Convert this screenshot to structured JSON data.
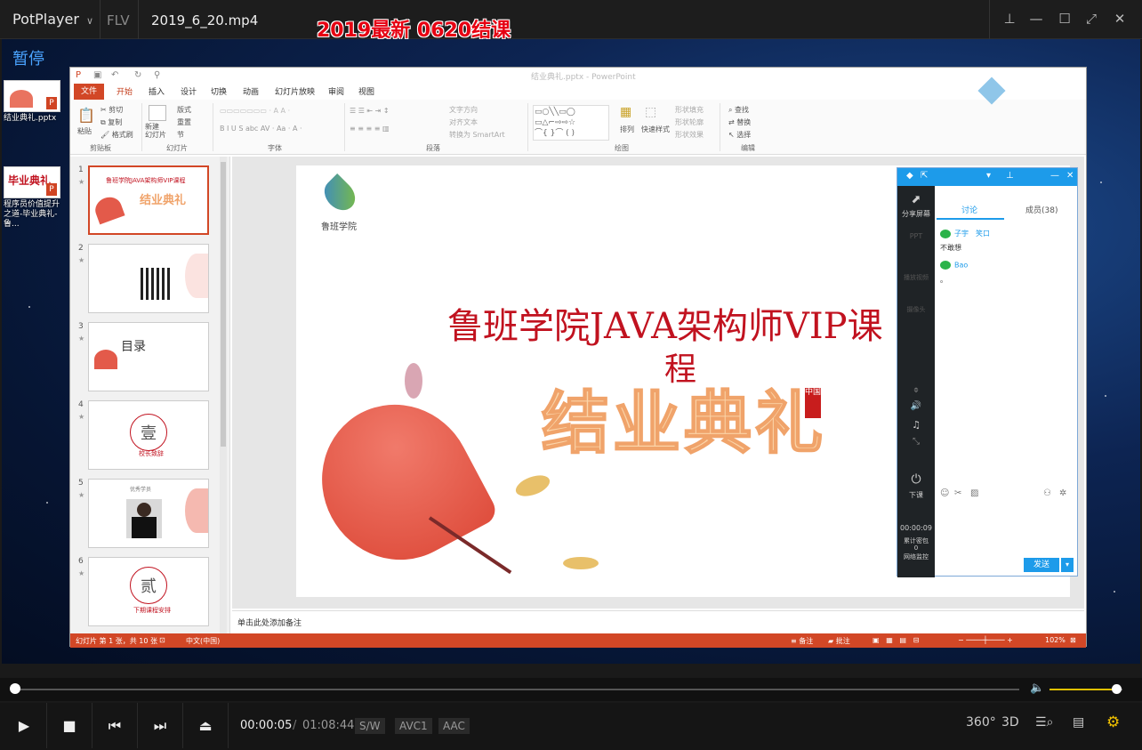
{
  "player": {
    "brand": "PotPlayer",
    "format": "FLV",
    "filename": "2019_6_20.mp4",
    "overlay_title": "2019最新  0620结课",
    "paused_label": "暂停",
    "time_current": "00:00:05",
    "time_separator": "/",
    "time_total": "01:08:44",
    "chips": [
      "S/W",
      "AVC1",
      "AAC"
    ],
    "progress": 0.0012,
    "volume": 0.92,
    "accent": "#e0c000",
    "icons": {
      "play": "play-icon",
      "stop": "stop-icon",
      "prev": "previous-icon",
      "next": "next-icon",
      "eject": "eject-icon",
      "vr": "360-icon",
      "three_d": "3d-icon",
      "playlist_search": "search-list-icon",
      "chapters": "chapters-icon",
      "settings": "gear-icon"
    },
    "right_labels": {
      "vr": "360°",
      "three_d": "3D"
    }
  },
  "desktop": {
    "icons": [
      {
        "label": "结业典礼.pptx"
      },
      {
        "label": "程序员价值提升之道-毕业典礼-鲁..."
      }
    ]
  },
  "ppt": {
    "window_title": "结业典礼.pptx - PowerPoint",
    "tabs": [
      "文件",
      "开始",
      "插入",
      "设计",
      "切换",
      "动画",
      "幻灯片放映",
      "审阅",
      "视图"
    ],
    "ribbon": {
      "paste": "粘贴",
      "cut": "剪切",
      "copy": "复制",
      "format_painter": "格式刷",
      "new_slide": "新建\n幻灯片",
      "layout": "版式",
      "reset": "重置",
      "section": "节",
      "text_direction": "文字方向",
      "align_text": "对齐文本",
      "smartart": "转换为 SmartArt",
      "arrange": "排列",
      "quick_styles": "快速样式",
      "shape_fill": "形状填充",
      "shape_outline": "形状轮廓",
      "shape_effects": "形状效果",
      "find": "查找",
      "replace": "替换",
      "select": "选择",
      "groups": [
        "剪贴板",
        "幻灯片",
        "字体",
        "段落",
        "绘图",
        "编辑"
      ]
    },
    "slides": [
      {
        "num": "1",
        "text": "鲁班学院JAVA架构师VIP课程",
        "sub": "结业典礼"
      },
      {
        "num": "2",
        "text": ""
      },
      {
        "num": "3",
        "text": "目录"
      },
      {
        "num": "4",
        "text": "壹",
        "sub": "校长致辞"
      },
      {
        "num": "5",
        "text": "优秀学员"
      },
      {
        "num": "6",
        "text": "贰",
        "sub": "下期课程安排"
      }
    ],
    "slide_main": {
      "logo_text": "鲁班学院",
      "title_line1": "鲁班学院JAVA架构师VIP课",
      "title_line2": "程",
      "headline": "结业典礼",
      "seal": "中国"
    },
    "notes_placeholder": "单击此处添加备注",
    "status": {
      "slide_info": "幻灯片 第 1 张，共 10 张",
      "lang": "中文(中国)",
      "notes": "备注",
      "comments": "批注",
      "zoom": "102%"
    }
  },
  "classroom": {
    "logo_text": "腾讯课堂",
    "side": [
      "分享屏幕",
      "PPT",
      "播放视频",
      "摄像头",
      "下课"
    ],
    "timer": "00:00:09",
    "stats": [
      "累计密包",
      "0",
      "网络监控"
    ],
    "tab_discussion": "讨论",
    "tab_members": "成员(38)",
    "messages": [
      {
        "name": "子宇",
        "extra": "笑口",
        "text": "不敢想"
      },
      {
        "name": "Bao",
        "extra": "",
        "text": "。"
      }
    ],
    "send": "发送"
  }
}
